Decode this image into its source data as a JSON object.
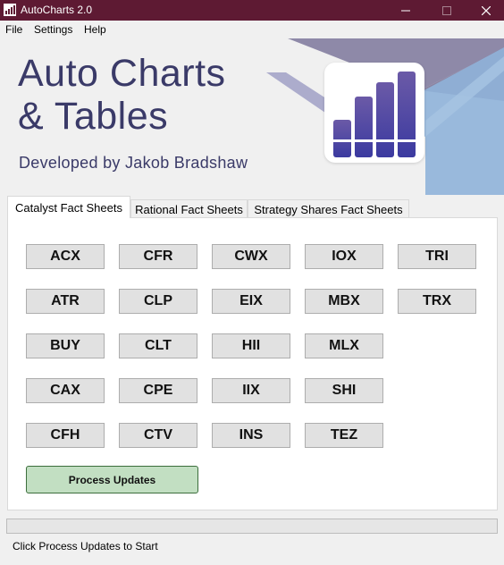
{
  "window": {
    "title": "AutoCharts 2.0",
    "title_bar_color": "#5e1a33"
  },
  "menu": [
    "File",
    "Settings",
    "Help"
  ],
  "header": {
    "title_line1": "Auto Charts",
    "title_line2": "& Tables",
    "subtitle": "Developed by Jakob Bradshaw",
    "logo_icon": "bar-chart-logo-icon",
    "accent_colors": [
      "#3a3a68",
      "#6b5aa7",
      "#8fb3d9"
    ]
  },
  "tabs": [
    {
      "label": "Catalyst Fact Sheets",
      "active": true
    },
    {
      "label": "Rational Fact Sheets",
      "active": false
    },
    {
      "label": "Strategy Shares Fact Sheets",
      "active": false
    }
  ],
  "ticker_rows": [
    [
      "ACX",
      "CFR",
      "CWX",
      "IOX",
      "TRI"
    ],
    [
      "ATR",
      "CLP",
      "EIX",
      "MBX",
      "TRX"
    ],
    [
      "BUY",
      "CLT",
      "HII",
      "MLX"
    ],
    [
      "CAX",
      "CPE",
      "IIX",
      "SHI"
    ],
    [
      "CFH",
      "CTV",
      "INS",
      "TEZ"
    ]
  ],
  "process_button": {
    "label": "Process Updates",
    "color": "#c2dfc2"
  },
  "progress": {
    "value": 0
  },
  "status": "Click Process Updates to Start"
}
